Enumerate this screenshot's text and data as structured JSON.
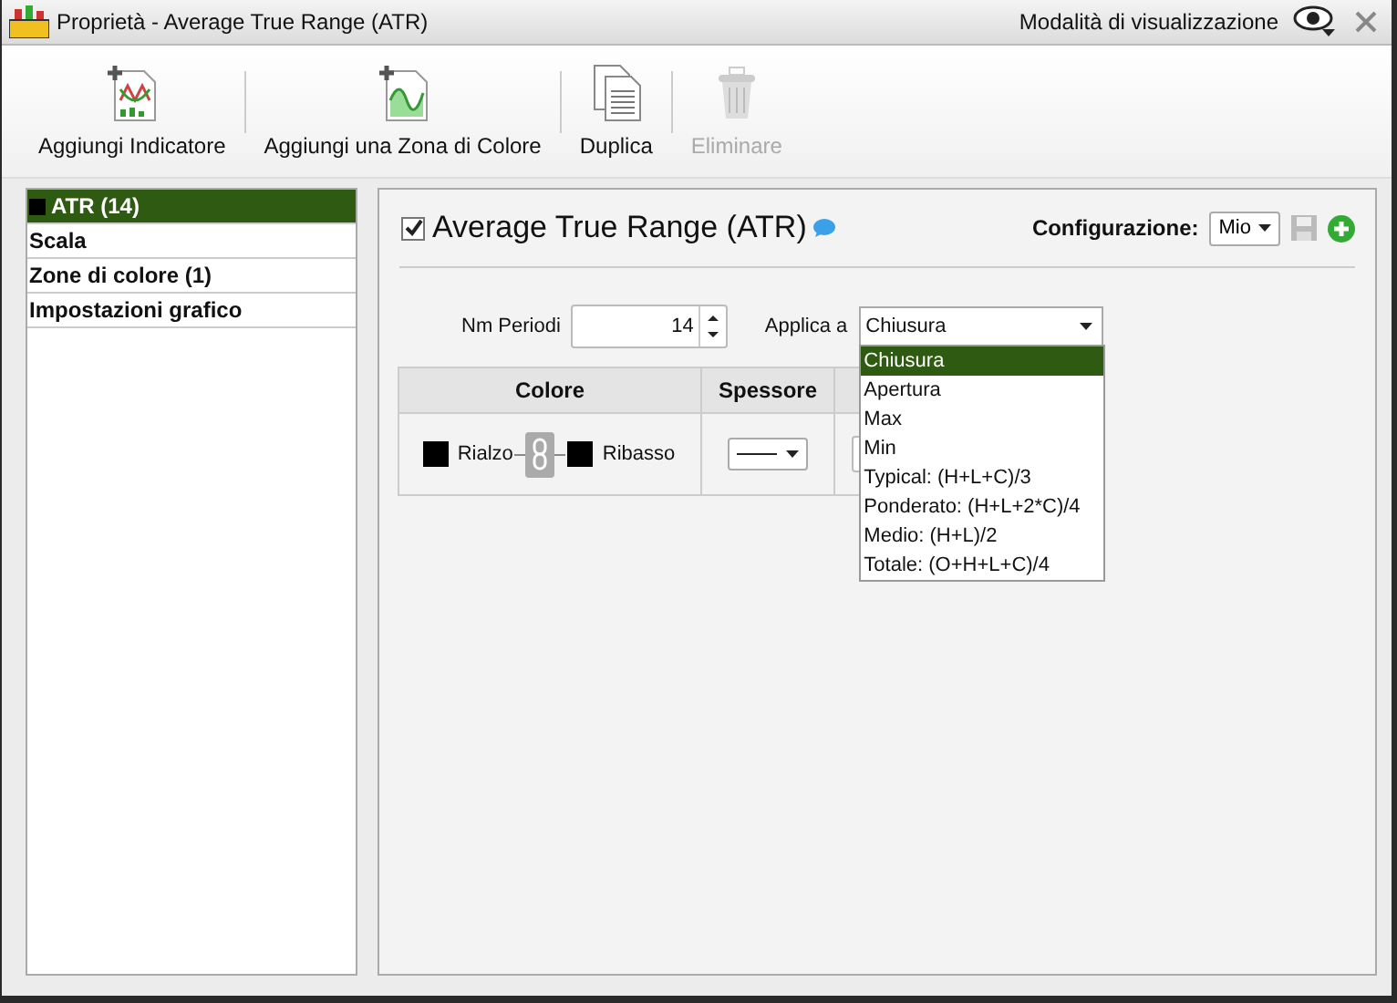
{
  "window": {
    "title": "Proprietà - Average True Range (ATR)",
    "view_mode": "Modalità di visualizzazione"
  },
  "toolbar": [
    {
      "label": "Aggiungi Indicatore",
      "kind": "indicator",
      "disabled": false
    },
    {
      "label": "Aggiungi una Zona di Colore",
      "kind": "zone",
      "disabled": false
    },
    {
      "label": "Duplica",
      "kind": "duplicate",
      "disabled": false
    },
    {
      "label": "Eliminare",
      "kind": "delete",
      "disabled": true
    }
  ],
  "sidebar": {
    "items": [
      {
        "label": "ATR (14)",
        "selected": true,
        "color": "#000000"
      },
      {
        "label": "Scala",
        "selected": false
      },
      {
        "label": "Zone di colore (1)",
        "selected": false
      },
      {
        "label": "Impostazioni grafico",
        "selected": false
      }
    ]
  },
  "panel": {
    "title": "Average True Range (ATR)",
    "enabled": true,
    "config_label": "Configurazione:",
    "config_value": "Mio",
    "periods": {
      "label": "Nm Periodi",
      "value": "14"
    },
    "apply_to": {
      "label": "Applica a",
      "value": "Chiusura",
      "expanded": true,
      "options": [
        {
          "label": "Chiusura",
          "selected": true
        },
        {
          "label": "Apertura",
          "selected": false
        },
        {
          "label": "Max",
          "selected": false
        },
        {
          "label": "Min",
          "selected": false
        },
        {
          "label": "Typical: (H+L+C)/3",
          "selected": false
        },
        {
          "label": "Ponderato: (H+L+2*C)/4",
          "selected": false
        },
        {
          "label": "Medio: (H+L)/2",
          "selected": false
        },
        {
          "label": "Totale: (O+H+L+C)/4",
          "selected": false
        }
      ]
    },
    "table": {
      "columns": [
        "Colore",
        "Spessore"
      ],
      "up_label": "Rialzo",
      "down_label": "Ribasso"
    }
  }
}
